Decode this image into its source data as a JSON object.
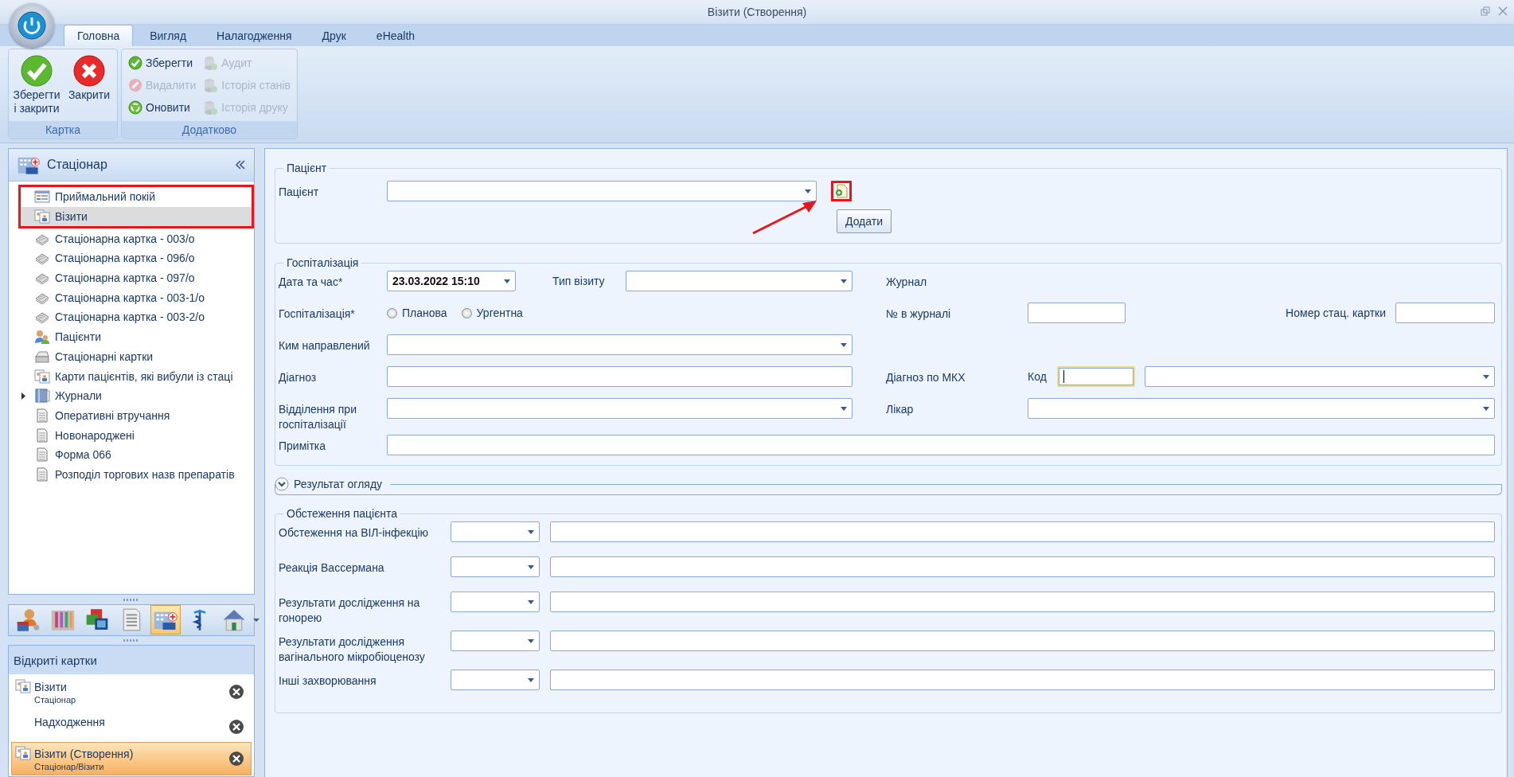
{
  "window": {
    "title": "Візити (Створення)"
  },
  "ribbon": {
    "tabs": [
      {
        "label": "Головна",
        "selected": true
      },
      {
        "label": "Вигляд",
        "selected": false
      },
      {
        "label": "Налагодження",
        "selected": false
      },
      {
        "label": "Друк",
        "selected": false
      },
      {
        "label": "eHealth",
        "selected": false
      }
    ],
    "groups": [
      {
        "title": "Картка",
        "kind": "large",
        "buttons": [
          {
            "label": "Зберегти і закрити",
            "kind": "save",
            "disabled": false
          },
          {
            "label": "Закрити",
            "kind": "close",
            "disabled": false
          }
        ]
      },
      {
        "title": "Додатково",
        "kind": "small",
        "buttons": [
          {
            "label": "Зберегти",
            "kind": "save",
            "disabled": false
          },
          {
            "label": "Видалити",
            "kind": "delete",
            "disabled": true
          },
          {
            "label": "Оновити",
            "kind": "refresh",
            "disabled": false
          },
          {
            "label": "Аудит",
            "kind": "database",
            "disabled": true
          },
          {
            "label": "Історія станів",
            "kind": "database",
            "disabled": true
          },
          {
            "label": "Історія друку",
            "kind": "database",
            "disabled": true
          }
        ]
      }
    ]
  },
  "navigator": {
    "title": "Стаціонар",
    "items": [
      {
        "label": "Приймальний покій",
        "kind": "reception",
        "selected": false,
        "highlighted": true
      },
      {
        "label": "Візити",
        "kind": "visits",
        "selected": true,
        "highlighted": true
      },
      {
        "label": "Стаціонарна картка - 003/о",
        "kind": "chart",
        "selected": false,
        "highlighted": false
      },
      {
        "label": "Стаціонарна картка - 096/о",
        "kind": "chart",
        "selected": false,
        "highlighted": false
      },
      {
        "label": "Стаціонарна картка - 097/о",
        "kind": "chart",
        "selected": false,
        "highlighted": false
      },
      {
        "label": "Стаціонарна картка - 003-1/о",
        "kind": "chart",
        "selected": false,
        "highlighted": false
      },
      {
        "label": "Стаціонарна картка - 003-2/о",
        "kind": "chart",
        "selected": false,
        "highlighted": false
      },
      {
        "label": "Пацієнти",
        "kind": "patients",
        "selected": false,
        "highlighted": false
      },
      {
        "label": "Стаціонарні картки",
        "kind": "cards",
        "selected": false,
        "highlighted": false
      },
      {
        "label": "Карти пацієнтів, які вибули із стаці",
        "kind": "visits",
        "selected": false,
        "highlighted": false
      },
      {
        "label": "Журнали",
        "kind": "journals",
        "selected": false,
        "highlighted": false,
        "expanded": false
      },
      {
        "label": "Оперативні втручання",
        "kind": "document",
        "selected": false,
        "highlighted": false
      },
      {
        "label": "Новонароджені",
        "kind": "document",
        "selected": false,
        "highlighted": false
      },
      {
        "label": "Форма 066",
        "kind": "document",
        "selected": false,
        "highlighted": false
      },
      {
        "label": "Розподіл торгових назв препаратів",
        "kind": "document",
        "selected": false,
        "highlighted": false
      }
    ],
    "modules": [
      {
        "kind": "calendar",
        "selected": false
      },
      {
        "kind": "lab",
        "selected": false
      },
      {
        "kind": "windows",
        "selected": false
      },
      {
        "kind": "list",
        "selected": false
      },
      {
        "kind": "hospital",
        "selected": true
      },
      {
        "kind": "medical",
        "selected": false
      },
      {
        "kind": "home",
        "selected": false
      }
    ]
  },
  "open_cards": {
    "title": "Відкриті картки",
    "items": [
      {
        "title": "Візити",
        "subtitle": "Стаціонар",
        "kind": "visits",
        "selected": false
      },
      {
        "title": "Надходження",
        "kind": "plain",
        "selected": false
      },
      {
        "title": "Візити (Створення)",
        "subtitle": "Стаціонар/Візити",
        "kind": "visits",
        "selected": true
      }
    ]
  },
  "patient": {
    "title": "Пацієнт",
    "label": "Пацієнт",
    "lookup_highlighted": true,
    "add_button": "Додати"
  },
  "hospitalization": {
    "title": "Госпіталізація",
    "date_label": "Дата та час*",
    "date_value": "23.03.2022 15:10",
    "visit_type_label": "Тип візиту",
    "journal_label": "Журнал",
    "type_label": "Госпіталізація*",
    "options": [
      {
        "label": "Планова",
        "selected": false
      },
      {
        "label": "Ургентна",
        "selected": false
      }
    ],
    "journal_number_label": "№ в журналі",
    "card_number_label": "Номер стац. картки",
    "referred_by_label": "Ким направлений",
    "diagnosis_label": "Діагноз",
    "icd_label": "Діагноз по МКХ",
    "code_label": "Код",
    "code_focused": true,
    "department_label": "Відділення при госпіталізації",
    "doctor_label": "Лікар",
    "note_label": "Примітка"
  },
  "review": {
    "title": "Результат огляду",
    "expanded": false
  },
  "examination": {
    "title": "Обстеження пацієнта",
    "rows": [
      {
        "label": "Обстеження на ВІЛ-інфекцію"
      },
      {
        "label": "Реакція Вассермана"
      },
      {
        "label": "Результати дослідження на гонорею"
      },
      {
        "label": "Результати дослідження вагінального мікробіоценозу"
      },
      {
        "label": "Інші захворювання"
      }
    ]
  }
}
